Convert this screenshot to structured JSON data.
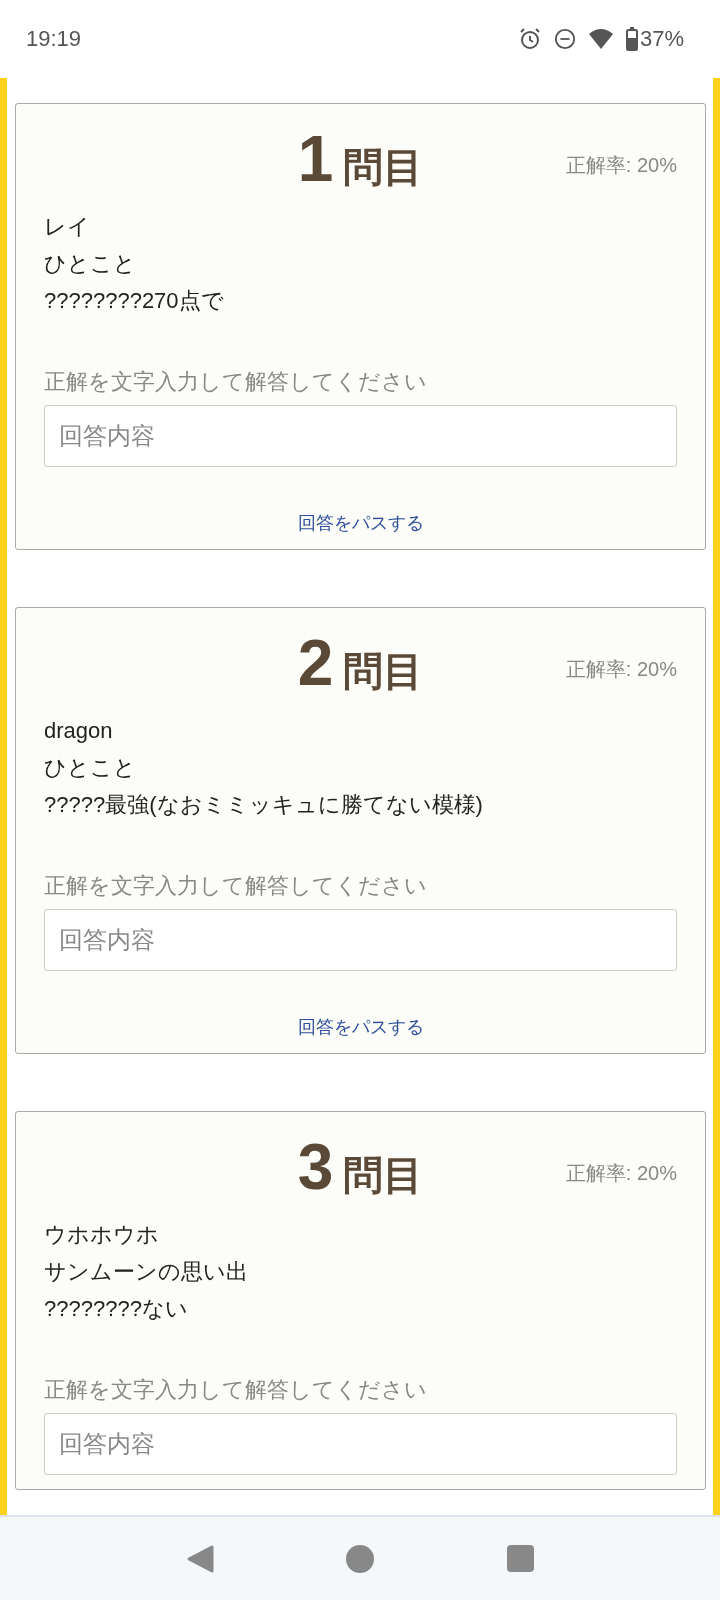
{
  "status_bar": {
    "time": "19:19",
    "battery": "37%"
  },
  "questions": [
    {
      "number": "1",
      "suffix": "問目",
      "accuracy": "正解率: 20%",
      "lines": [
        "レイ",
        "ひとこと",
        "????????270点で"
      ],
      "answer_label": "正解を文字入力して解答してください",
      "answer_placeholder": "回答内容",
      "pass_link": "回答をパスする"
    },
    {
      "number": "2",
      "suffix": "問目",
      "accuracy": "正解率: 20%",
      "lines": [
        "dragon",
        "ひとこと",
        "?????最強(なおミミッキュに勝てない模様)"
      ],
      "answer_label": "正解を文字入力して解答してください",
      "answer_placeholder": "回答内容",
      "pass_link": "回答をパスする"
    },
    {
      "number": "3",
      "suffix": "問目",
      "accuracy": "正解率: 20%",
      "lines": [
        "ウホホウホ",
        "サンムーンの思い出",
        "????????ない"
      ],
      "answer_label": "正解を文字入力して解答してください",
      "answer_placeholder": "回答内容"
    }
  ]
}
